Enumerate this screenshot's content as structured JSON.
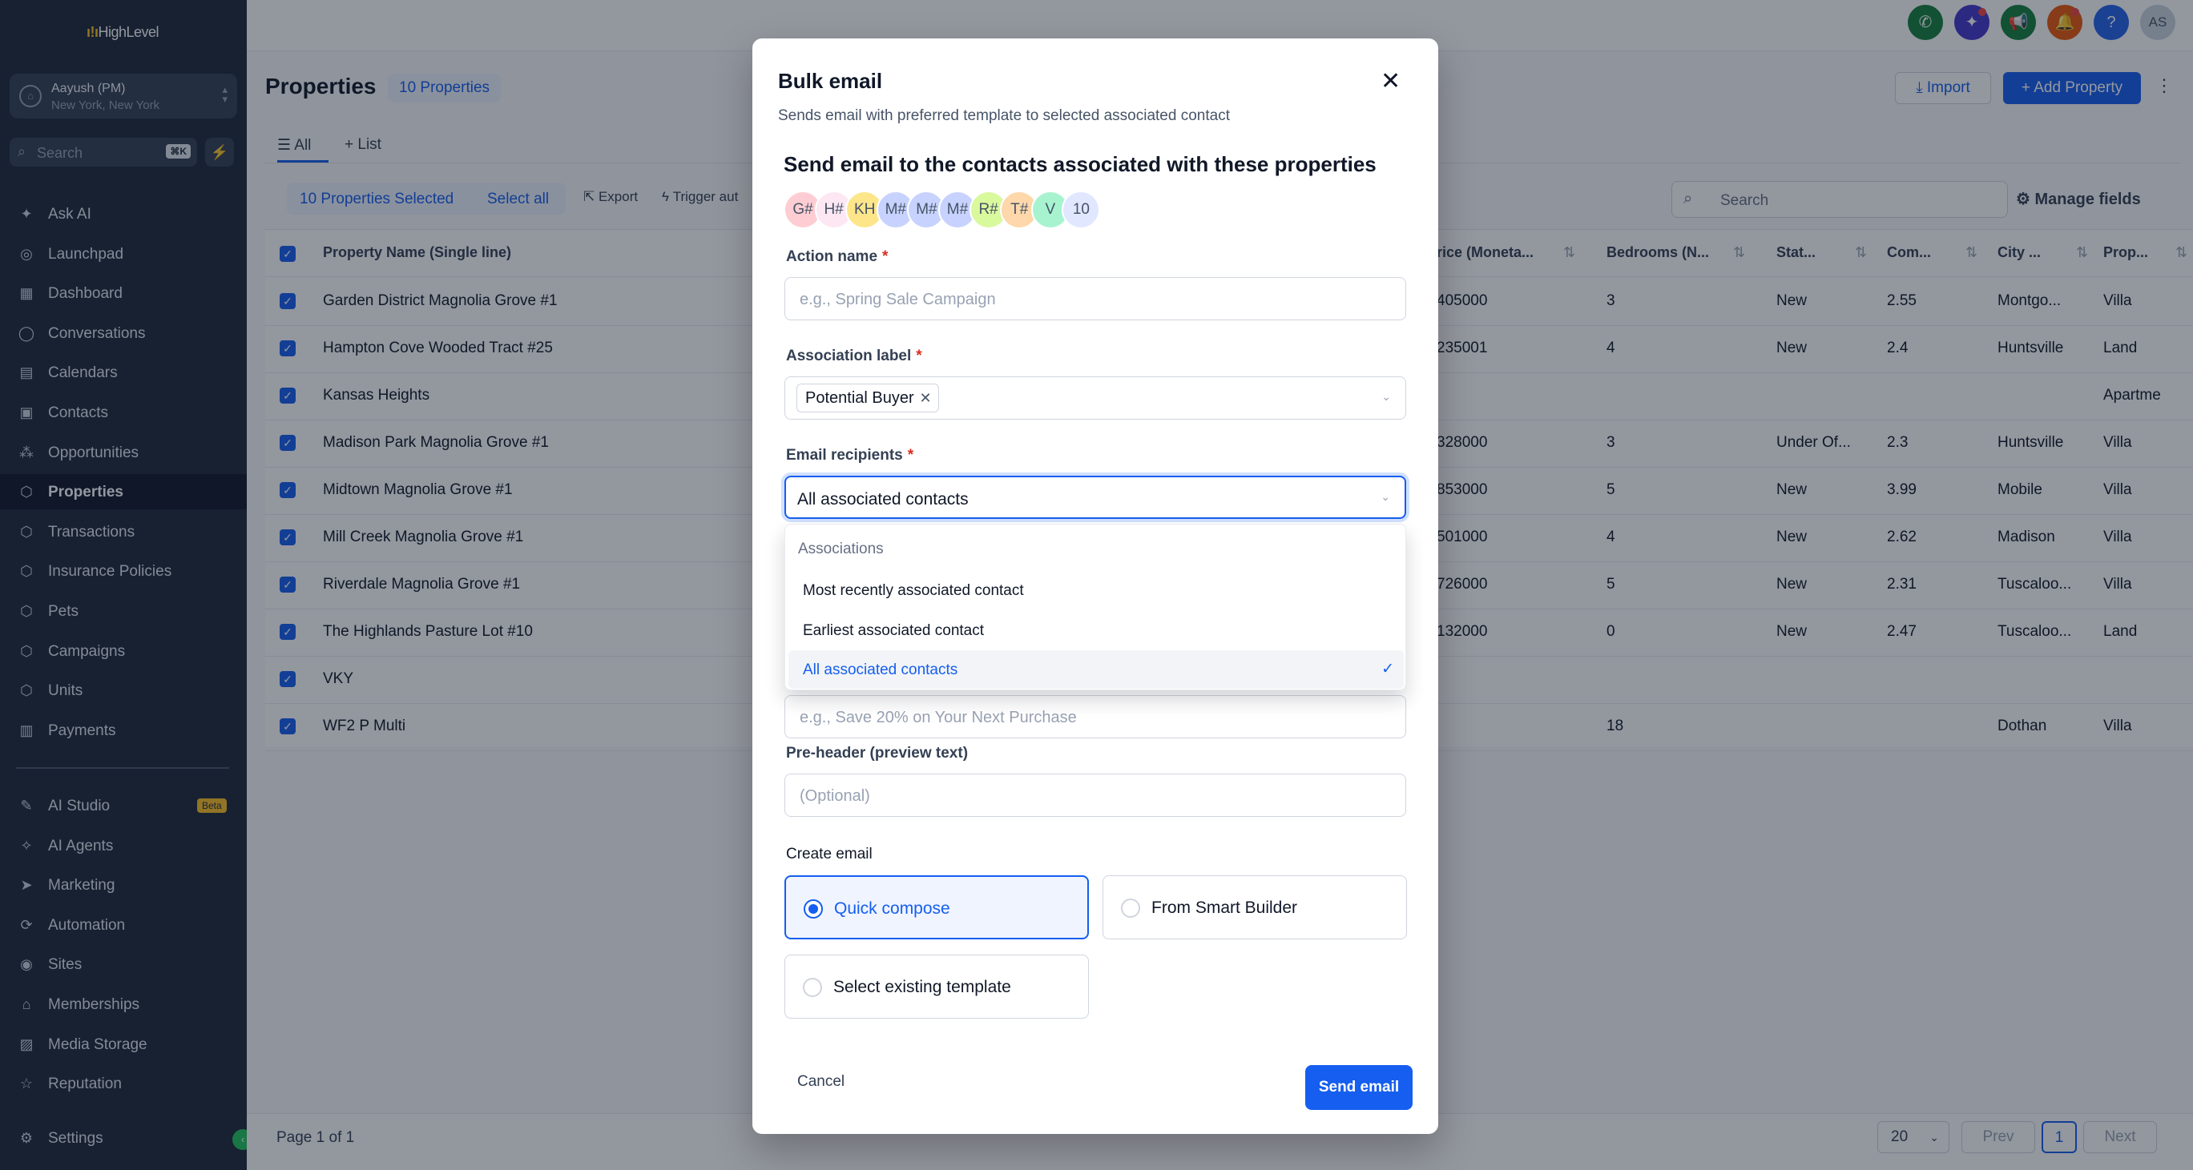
{
  "colors": {
    "primary": "#155eef",
    "sidebar_bg": "#1e293b",
    "success": "#22c55e",
    "danger": "#d92d20"
  },
  "sidebar": {
    "logo": "HighLevel",
    "account": {
      "name": "Aayush (PM)",
      "location": "New York, New York"
    },
    "search": {
      "placeholder": "Search",
      "shortcut": "⌘K"
    },
    "items": [
      {
        "label": "Ask AI",
        "icon": "sparkle-icon"
      },
      {
        "label": "Launchpad",
        "icon": "rocket-icon"
      },
      {
        "label": "Dashboard",
        "icon": "grid-icon"
      },
      {
        "label": "Conversations",
        "icon": "chat-icon"
      },
      {
        "label": "Calendars",
        "icon": "calendar-icon"
      },
      {
        "label": "Contacts",
        "icon": "contacts-icon"
      },
      {
        "label": "Opportunities",
        "icon": "funnel-icon"
      },
      {
        "label": "Properties",
        "icon": "cube-icon",
        "active": true
      },
      {
        "label": "Transactions",
        "icon": "cube-icon"
      },
      {
        "label": "Insurance Policies",
        "icon": "cube-icon"
      },
      {
        "label": "Pets",
        "icon": "cube-icon"
      },
      {
        "label": "Campaigns",
        "icon": "cube-icon"
      },
      {
        "label": "Units",
        "icon": "cube-icon"
      },
      {
        "label": "Payments",
        "icon": "receipt-icon"
      }
    ],
    "items2": [
      {
        "label": "AI Studio",
        "icon": "studio-icon",
        "badge": "Beta"
      },
      {
        "label": "AI Agents",
        "icon": "agents-icon"
      },
      {
        "label": "Marketing",
        "icon": "send-icon"
      },
      {
        "label": "Automation",
        "icon": "automation-icon"
      },
      {
        "label": "Sites",
        "icon": "globe-icon"
      },
      {
        "label": "Memberships",
        "icon": "graduation-icon"
      },
      {
        "label": "Media Storage",
        "icon": "image-icon"
      },
      {
        "label": "Reputation",
        "icon": "star-icon"
      }
    ],
    "settings": "Settings"
  },
  "topbar": {
    "user_initials": "AS"
  },
  "page": {
    "title": "Properties",
    "count_badge": "10 Properties",
    "import_label": "Import",
    "add_label": "Add Property",
    "tabs": [
      "All",
      "List"
    ],
    "selected_text": "10 Properties Selected",
    "select_all": "Select all",
    "export_label": "Export",
    "trigger_label": "Trigger aut",
    "search_placeholder": "Search",
    "manage_fields": "Manage fields"
  },
  "table": {
    "columns": [
      "Property Name (Single line)",
      "rice (Moneta...",
      "Bedrooms (N...",
      "Stat...",
      "Com...",
      "City ...",
      "Prop..."
    ],
    "rows": [
      [
        "Garden District Magnolia Grove #1",
        "405000",
        "3",
        "New",
        "2.55",
        "Montgo...",
        "Villa"
      ],
      [
        "Hampton Cove Wooded Tract #25",
        "235001",
        "4",
        "New",
        "2.4",
        "Huntsville",
        "Land"
      ],
      [
        "Kansas Heights",
        "",
        "",
        "",
        "",
        "",
        "Apartme"
      ],
      [
        "Madison Park Magnolia Grove #1",
        "328000",
        "3",
        "Under Of...",
        "2.3",
        "Huntsville",
        "Villa"
      ],
      [
        "Midtown Magnolia Grove #1",
        "853000",
        "5",
        "New",
        "3.99",
        "Mobile",
        "Villa"
      ],
      [
        "Mill Creek Magnolia Grove #1",
        "501000",
        "4",
        "New",
        "2.62",
        "Madison",
        "Villa"
      ],
      [
        "Riverdale Magnolia Grove #1",
        "726000",
        "5",
        "New",
        "2.31",
        "Tuscaloo...",
        "Villa"
      ],
      [
        "The Highlands Pasture Lot #10",
        "132000",
        "0",
        "New",
        "2.47",
        "Tuscaloo...",
        "Land"
      ],
      [
        "VKY",
        "",
        "",
        "",
        "",
        "",
        ""
      ],
      [
        "WF2 P Multi",
        "",
        "18",
        "",
        "",
        "Dothan",
        "Villa"
      ]
    ]
  },
  "footer": {
    "page_text": "Page 1 of 1",
    "page_size": "20",
    "prev": "Prev",
    "current": "1",
    "next": "Next"
  },
  "modal": {
    "title": "Bulk email",
    "subtitle": "Sends email with preferred template to selected associated contact",
    "heading": "Send email to the contacts associated with these properties",
    "avatars": [
      {
        "text": "G#",
        "color": "#fecdd3"
      },
      {
        "text": "H#",
        "color": "#fce7f3"
      },
      {
        "text": "KH",
        "color": "#fde68a"
      },
      {
        "text": "M#",
        "color": "#c7d2fe"
      },
      {
        "text": "M#",
        "color": "#c7d2fe"
      },
      {
        "text": "M#",
        "color": "#c7d2fe"
      },
      {
        "text": "R#",
        "color": "#d9f99d"
      },
      {
        "text": "T#",
        "color": "#fed7aa"
      },
      {
        "text": "V",
        "color": "#a7f3d0"
      },
      {
        "text": "10",
        "color": "#e0e7ff"
      }
    ],
    "action_name": {
      "label": "Action name",
      "placeholder": "e.g., Spring Sale Campaign"
    },
    "association_label": {
      "label": "Association label",
      "tag": "Potential Buyer"
    },
    "email_recipients": {
      "label": "Email recipients",
      "value": "All associated contacts"
    },
    "dropdown": {
      "group": "Associations",
      "options": [
        "Most recently associated contact",
        "Earliest associated contact",
        "All associated contacts"
      ],
      "selected": "All associated contacts"
    },
    "subject_placeholder": "e.g., Save 20% on Your Next Purchase",
    "preheader": {
      "label": "Pre-header (preview text)",
      "placeholder": "(Optional)"
    },
    "create_email": {
      "label": "Create email",
      "options": [
        "Quick compose",
        "From Smart Builder",
        "Select existing template"
      ],
      "selected": "Quick compose"
    },
    "cancel": "Cancel",
    "send": "Send email"
  }
}
